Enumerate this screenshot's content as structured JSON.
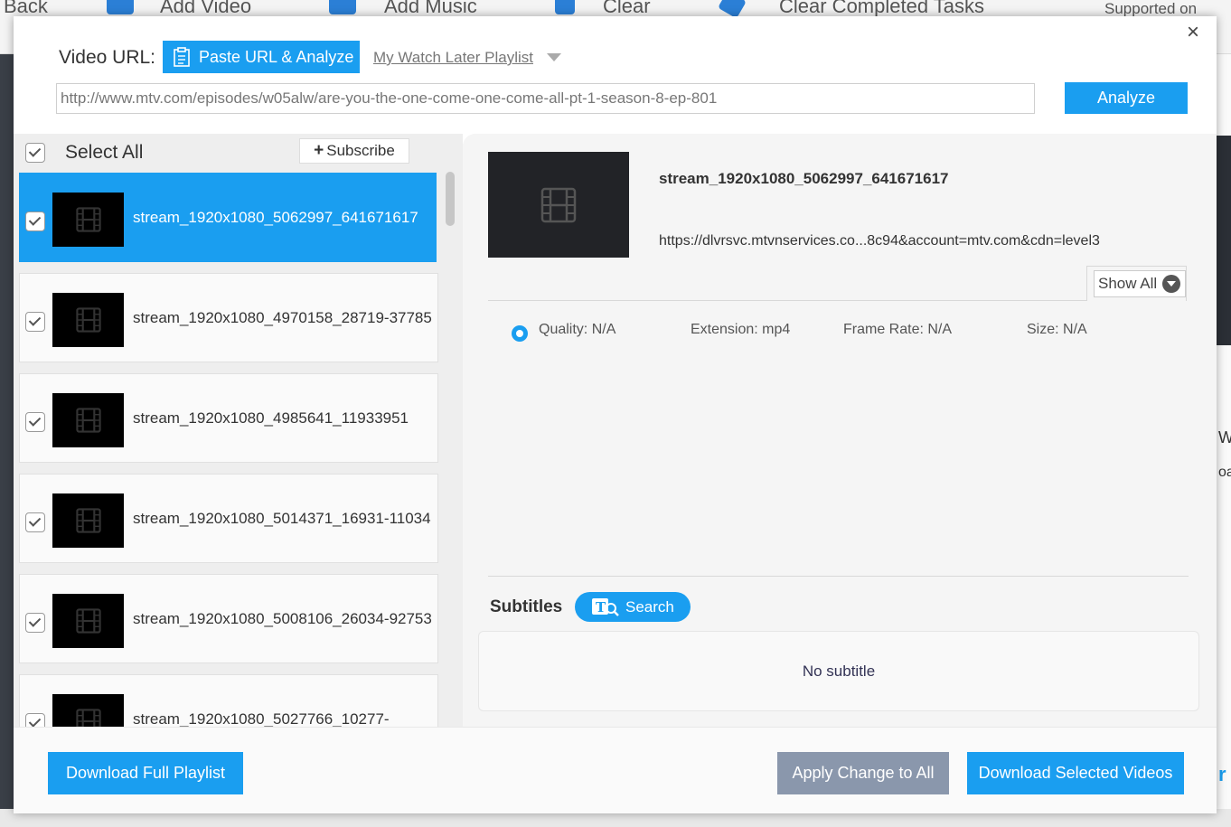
{
  "background_app": {
    "toolbar_items": [
      "Back",
      "Add Video",
      "Add Music",
      "Clear",
      "Clear Completed Tasks",
      "Supported on"
    ],
    "right_fragments": [
      "W",
      "oa",
      "r"
    ]
  },
  "dialog": {
    "close_glyph": "×",
    "url_label": "Video URL:",
    "paste_button": "Paste URL & Analyze",
    "playlist_link": "My Watch Later Playlist",
    "url_value": "http://www.mtv.com/episodes/w05alw/are-you-the-one-come-one-come-all-pt-1-season-8-ep-801",
    "analyze_button": "Analyze"
  },
  "left_panel": {
    "select_all": "Select All",
    "subscribe_plus": "+",
    "subscribe": "Subscribe",
    "items": [
      {
        "title": "stream_1920x1080_5062997_641671617",
        "checked": true,
        "selected": true
      },
      {
        "title": "stream_1920x1080_4970158_28719-37785",
        "checked": true,
        "selected": false
      },
      {
        "title": "stream_1920x1080_4985641_11933951",
        "checked": true,
        "selected": false
      },
      {
        "title": "stream_1920x1080_5014371_16931-11034",
        "checked": true,
        "selected": false
      },
      {
        "title": "stream_1920x1080_5008106_26034-92753",
        "checked": true,
        "selected": false
      },
      {
        "title": "stream_1920x1080_5027766_10277-",
        "checked": true,
        "selected": false
      }
    ]
  },
  "detail": {
    "title": "stream_1920x1080_5062997_641671617",
    "url": "https://dlvrsvc.mtvnservices.co...8c94&account=mtv.com&cdn=level3",
    "show_all": "Show All",
    "quality": "Quality: N/A",
    "extension": "Extension: mp4",
    "frame_rate": "Frame Rate: N/A",
    "size": "Size: N/A",
    "subtitles_label": "Subtitles",
    "search_button": "Search",
    "no_subtitle": "No subtitle"
  },
  "footer": {
    "download_full": "Download Full Playlist",
    "apply_change": "Apply Change to All",
    "download_selected": "Download Selected Videos"
  },
  "colors": {
    "accent": "#1a9ef0",
    "apply_button": "#8a97ac",
    "thumbnail": "#000000"
  }
}
